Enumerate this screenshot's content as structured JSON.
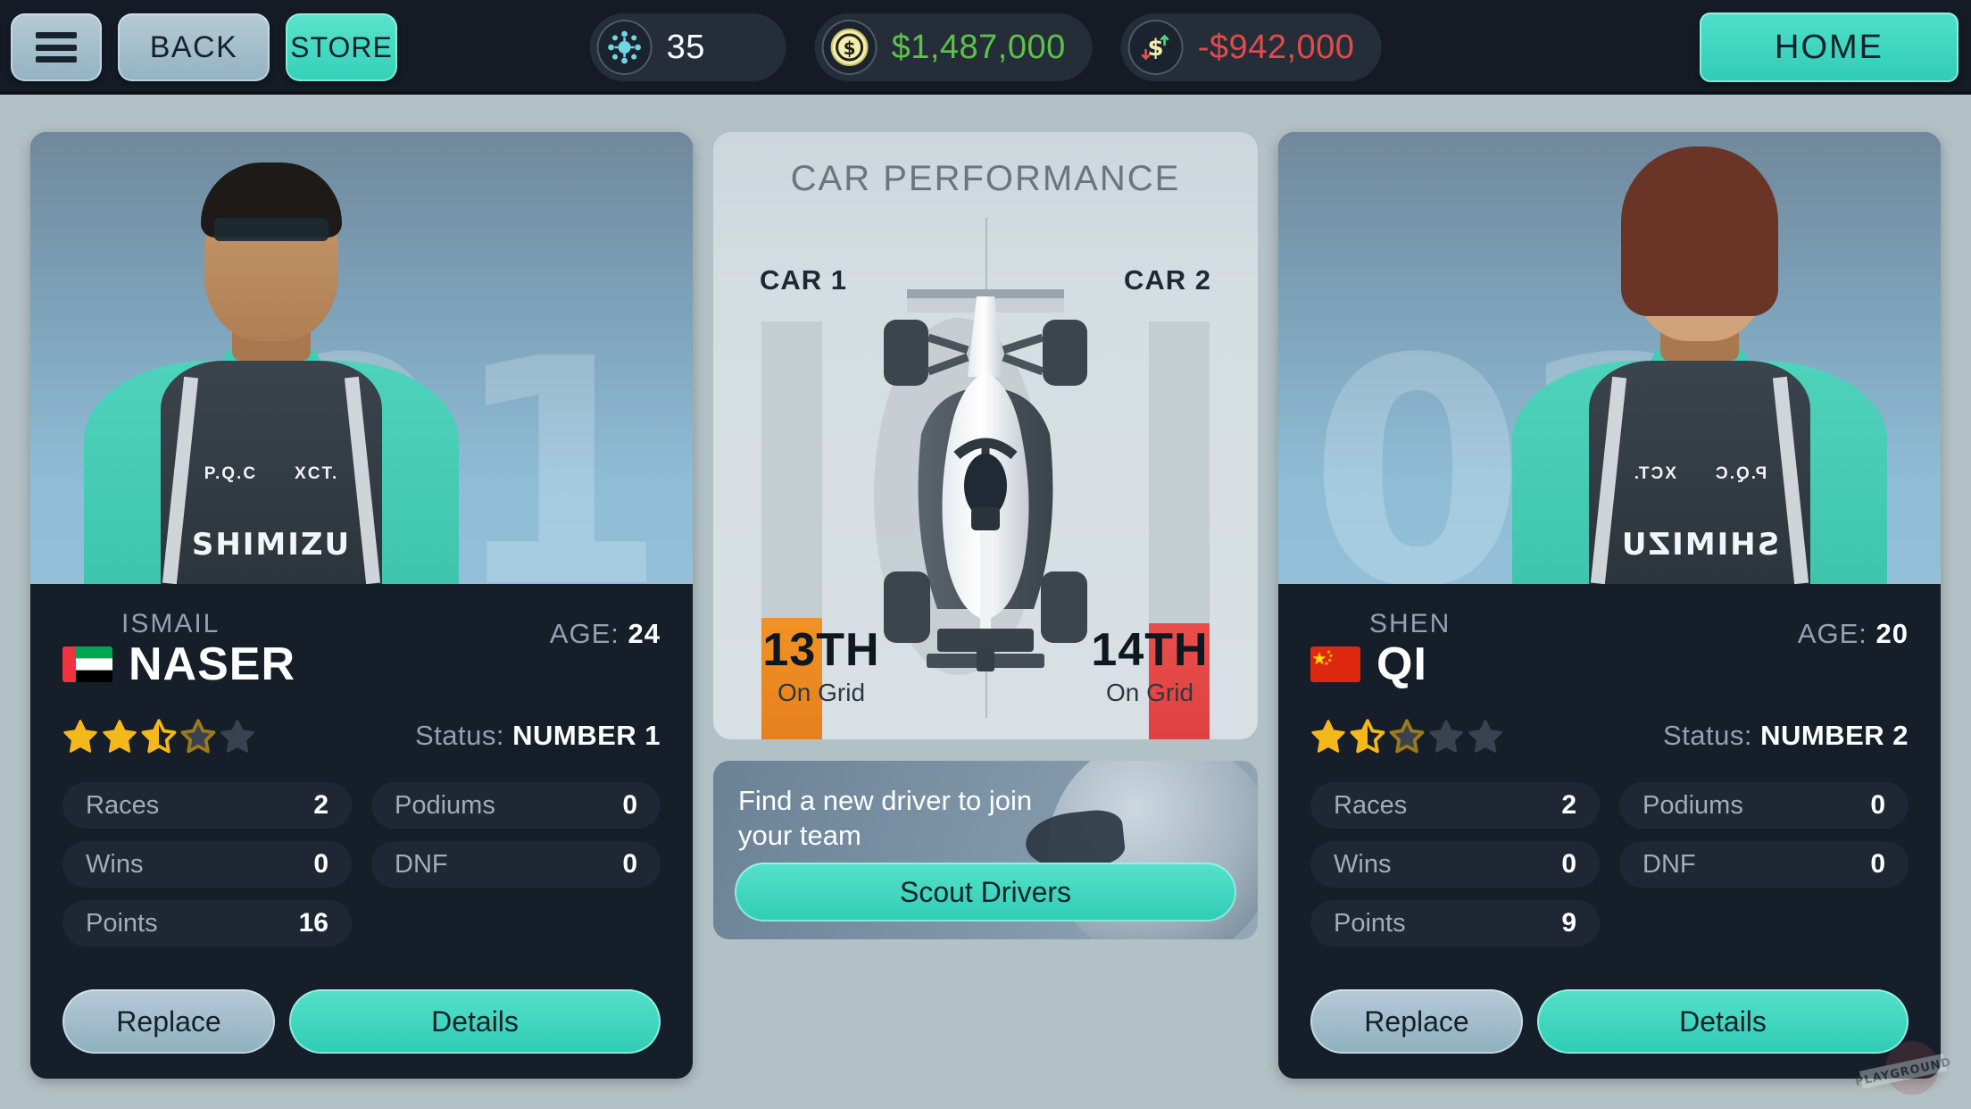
{
  "topbar": {
    "menu_icon": "hamburger-icon",
    "back_label": "BACK",
    "store_label": "STORE",
    "home_label": "HOME",
    "resources": [
      {
        "icon": "token-icon",
        "value": "35",
        "color": "#ffffff"
      },
      {
        "icon": "coin-icon",
        "value": "$1,487,000",
        "color": "#5cc24a"
      },
      {
        "icon": "cashflow-icon",
        "value": "-$942,000",
        "color": "#e14b4b"
      }
    ]
  },
  "drivers": [
    {
      "slot_number": "01",
      "first_name": "ISMAIL",
      "last_name": "NASER",
      "flag": "ae",
      "age_label": "AGE:",
      "age": "24",
      "rating": 2.5,
      "status_label": "Status:",
      "status_value": "NUMBER 1",
      "stats": [
        {
          "label": "Races",
          "value": "2"
        },
        {
          "label": "Podiums",
          "value": "0"
        },
        {
          "label": "Wins",
          "value": "0"
        },
        {
          "label": "DNF",
          "value": "0"
        },
        {
          "label": "Points",
          "value": "16"
        }
      ],
      "replace_label": "Replace",
      "details_label": "Details",
      "suit_brand": "SHIMIZU",
      "suit_sponsors": [
        "P.Q.C",
        "XCT."
      ]
    },
    {
      "slot_number": "02",
      "first_name": "SHEN",
      "last_name": "QI",
      "flag": "cn",
      "age_label": "AGE:",
      "age": "20",
      "rating": 1.5,
      "status_label": "Status:",
      "status_value": "NUMBER 2",
      "stats": [
        {
          "label": "Races",
          "value": "2"
        },
        {
          "label": "Podiums",
          "value": "0"
        },
        {
          "label": "Wins",
          "value": "0"
        },
        {
          "label": "DNF",
          "value": "0"
        },
        {
          "label": "Points",
          "value": "9"
        }
      ],
      "replace_label": "Replace",
      "details_label": "Details",
      "suit_brand": "SHIMIZU",
      "suit_sponsors": [
        "P.Q.C",
        "XCT."
      ]
    }
  ],
  "car_performance": {
    "title": "CAR PERFORMANCE",
    "car1": {
      "label": "CAR 1",
      "rank": "13TH",
      "sub": "On Grid",
      "fill_pct": 39,
      "color": "#e8821f"
    },
    "car2": {
      "label": "CAR 2",
      "rank": "14TH",
      "sub": "On Grid",
      "fill_pct": 38,
      "color": "#e04543"
    }
  },
  "scout": {
    "headline": "Find a new driver to join your team",
    "button_label": "Scout Drivers"
  },
  "watermark": "PLAYGROUND",
  "colors": {
    "accent_teal": "#3ad0ba",
    "panel_dark": "#161e2a",
    "page_bg": "#b2c1c5",
    "gold": "#f4b81b",
    "money_positive": "#5cc24a",
    "money_negative": "#e14b4b"
  },
  "chart_data": {
    "type": "bar",
    "title": "CAR PERFORMANCE",
    "categories": [
      "CAR 1",
      "CAR 2"
    ],
    "values": [
      39,
      38
    ],
    "value_labels": [
      "13TH",
      "14TH"
    ],
    "ylabel": "",
    "xlabel": "",
    "ylim": [
      0,
      100
    ],
    "orientation": "vertical",
    "colors": [
      "#e8821f",
      "#e04543"
    ],
    "track_color": "#c3cdd2",
    "grid": false,
    "legend": false,
    "annotations": [
      "13TH On Grid",
      "14TH On Grid"
    ]
  }
}
